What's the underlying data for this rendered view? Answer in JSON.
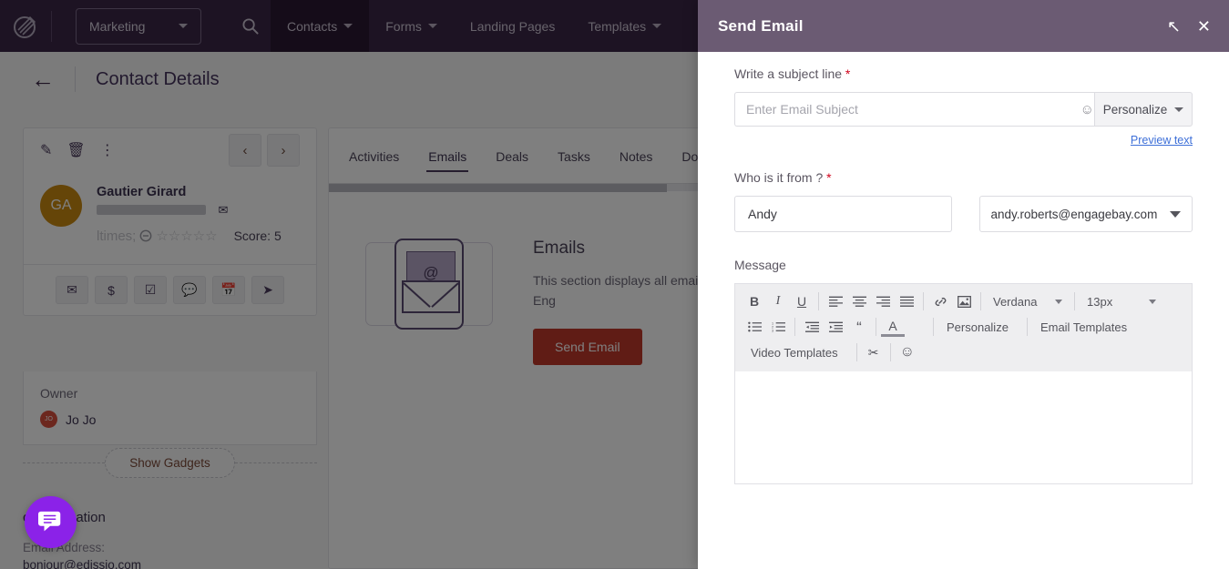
{
  "topnav": {
    "logo_alt": "engagebay-logo",
    "brand": "Marketing",
    "search_icon": "search-icon",
    "items": [
      {
        "label": "Contacts",
        "has_caret": true,
        "active": true
      },
      {
        "label": "Forms",
        "has_caret": true,
        "active": false
      },
      {
        "label": "Landing Pages",
        "has_caret": false,
        "active": false
      },
      {
        "label": "Templates",
        "has_caret": true,
        "active": false
      }
    ]
  },
  "page": {
    "back_icon": "back-arrow-icon",
    "title": "Contact Details"
  },
  "contact_card": {
    "tools": [
      {
        "name": "edit-icon",
        "glyph": "✎"
      },
      {
        "name": "delete-icon",
        "glyph": "🗑"
      },
      {
        "name": "more-options-icon",
        "glyph": "⋮"
      }
    ],
    "prev_label": "‹",
    "next_label": "›",
    "avatar_initials": "GA",
    "avatar_color": "#cb8a11",
    "name": "Gautier Girard",
    "email_icon": "envelope-icon",
    "rating_icon": "no-rating-icon",
    "stars": "☆☆☆☆☆",
    "score": "Score: 5",
    "actions": [
      {
        "name": "email-action-icon",
        "glyph": "✉"
      },
      {
        "name": "deal-action-icon",
        "glyph": "$"
      },
      {
        "name": "task-action-icon",
        "glyph": "☑"
      },
      {
        "name": "note-action-icon",
        "glyph": "💬"
      },
      {
        "name": "appointment-action-icon",
        "glyph": "📅"
      },
      {
        "name": "send-action-icon",
        "glyph": "➤"
      }
    ]
  },
  "owner": {
    "label": "Owner",
    "initials": "JO",
    "name": "Jo Jo"
  },
  "gadgets": {
    "label": "Show Gadgets"
  },
  "contact_information": {
    "title": "ct Information",
    "email_label": "Email Address:",
    "email_value": "bonjour@edissio.com"
  },
  "chat_widget": {
    "icon": "chat-bubble-icon",
    "color": "#8b22e8"
  },
  "center": {
    "tabs": [
      {
        "label": "Activities",
        "active": false
      },
      {
        "label": "Emails",
        "active": true
      },
      {
        "label": "Deals",
        "active": false
      },
      {
        "label": "Tasks",
        "active": false
      },
      {
        "label": "Notes",
        "active": false
      },
      {
        "label": "Doc",
        "active": false
      }
    ],
    "empty": {
      "icon": "email-envelope-illustration",
      "at_symbol": "@",
      "heading": "Emails",
      "description": "This section displays all emails delivered using Eng",
      "button_label": "Send Email",
      "button_color": "#c0392b"
    }
  },
  "modal": {
    "title": "Send Email",
    "expand_icon": "expand-arrow-icon",
    "close_icon": "close-icon",
    "subject": {
      "label": "Write a subject line",
      "required": "*",
      "placeholder": "Enter Email Subject",
      "value": "",
      "emoji_icon": "emoji-smiley-icon",
      "personalize_label": "Personalize",
      "preview_link": "Preview text"
    },
    "from": {
      "label": "Who is it from ?",
      "required": "*",
      "name_value": "Andy",
      "email_value": "andy.roberts@engagebay.com"
    },
    "message": {
      "label": "Message",
      "toolbar": {
        "row1": [
          {
            "name": "bold-icon",
            "glyph": "B"
          },
          {
            "name": "italic-icon",
            "glyph": "I"
          },
          {
            "name": "underline-icon",
            "glyph": "U"
          },
          {
            "name": "align-left-icon",
            "glyph": "☰"
          },
          {
            "name": "align-center-icon",
            "glyph": "☰"
          },
          {
            "name": "align-right-icon",
            "glyph": "☰"
          },
          {
            "name": "align-justify-icon",
            "glyph": "☰"
          },
          {
            "name": "insert-link-icon",
            "glyph": "🔗"
          },
          {
            "name": "insert-image-icon",
            "glyph": "🖼"
          }
        ],
        "font_family": "Verdana",
        "font_size": "13px",
        "row2": [
          {
            "name": "bullet-list-icon",
            "glyph": "☰"
          },
          {
            "name": "numbered-list-icon",
            "glyph": "☰"
          },
          {
            "name": "outdent-icon",
            "glyph": "☰"
          },
          {
            "name": "indent-icon",
            "glyph": "☰"
          },
          {
            "name": "blockquote-icon",
            "glyph": "“"
          },
          {
            "name": "text-color-icon",
            "glyph": "A"
          }
        ],
        "personalize_label": "Personalize",
        "email_templates_label": "Email Templates",
        "video_templates_label": "Video Templates",
        "scissors_icon": "scissors-icon",
        "scissors_glyph": "✂",
        "emoji_icon": "emoji-smiley-icon",
        "emoji_glyph": "☺"
      },
      "body_value": ""
    }
  }
}
